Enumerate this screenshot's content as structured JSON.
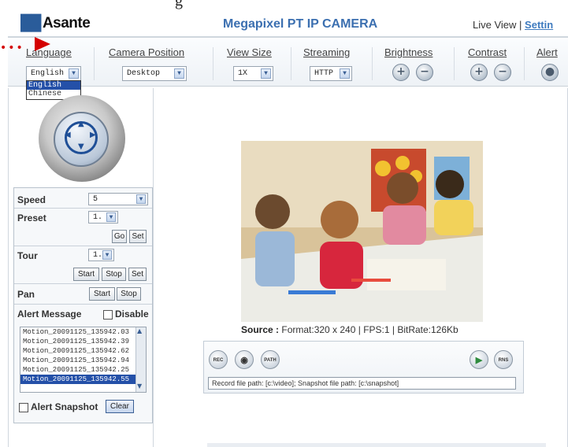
{
  "header": {
    "logo_text": "Asante",
    "camera_title": "Megapixel PT IP CAMERA",
    "live_view": "Live View",
    "separator": "|",
    "settings": "Settin",
    "cut_text": "g"
  },
  "tabs": [
    {
      "label": "Language",
      "value": "English"
    },
    {
      "label": "Camera Position",
      "value": "Desktop"
    },
    {
      "label": "View Size",
      "value": "1X"
    },
    {
      "label": "Streaming",
      "value": "HTTP"
    },
    {
      "label": "Brightness",
      "plus": "+",
      "minus": "−"
    },
    {
      "label": "Contrast",
      "plus": "+",
      "minus": "−"
    },
    {
      "label": "Alert"
    }
  ],
  "language_dropdown": {
    "options": [
      "English",
      "Chinese"
    ],
    "selected": "English"
  },
  "controls": {
    "speed_label": "Speed",
    "speed_value": "5",
    "preset_label": "Preset",
    "preset_value": "1.",
    "go": "Go",
    "set": "Set",
    "tour_label": "Tour",
    "tour_value": "1.",
    "tour_start": "Start",
    "tour_stop": "Stop",
    "tour_set": "Set",
    "pan_label": "Pan",
    "pan_start": "Start",
    "pan_stop": "Stop",
    "alert_message_label": "Alert Message",
    "disable_label": "Disable",
    "messages": [
      "Motion_20091125_135942.03",
      "Motion_20091125_135942.39",
      "Motion_20091125_135942.62",
      "Motion_20091125_135942.94",
      "Motion_20091125_135942.25",
      "Motion_20091125_135942.55"
    ],
    "selected_message_index": 5,
    "alert_snapshot_label": "Alert Snapshot",
    "clear": "Clear"
  },
  "video": {
    "source_label": "Source :",
    "source_info": "Format:320 x 240 | FPS:1 | BitRate:126Kb"
  },
  "toolbar": {
    "rec": "REC",
    "path": "PATH",
    "rns": "RNS",
    "file_path_text": "Record file path: [c:\\video]; Snapshot file path: [c:\\snapshot]"
  },
  "colors": {
    "title_blue": "#3b6fb0",
    "link_blue": "#3f7bbf",
    "annotation_red": "#d40000",
    "selection_blue": "#2450a8"
  }
}
